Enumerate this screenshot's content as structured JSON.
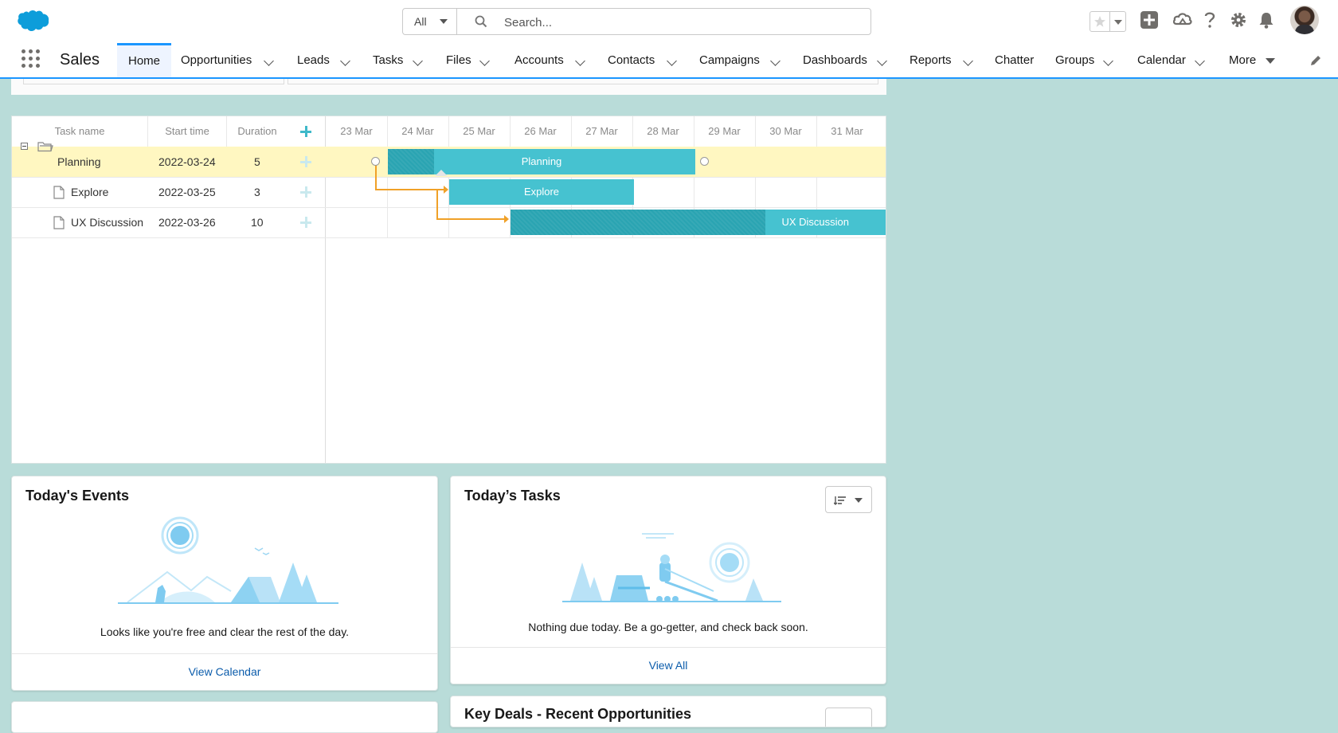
{
  "header": {
    "search": {
      "scope": "All",
      "placeholder": "Search..."
    }
  },
  "nav": {
    "app_name": "Sales",
    "tabs": [
      {
        "label": "Home",
        "active": true
      },
      {
        "label": "Opportunities"
      },
      {
        "label": "Leads"
      },
      {
        "label": "Tasks"
      },
      {
        "label": "Files"
      },
      {
        "label": "Accounts"
      },
      {
        "label": "Contacts"
      },
      {
        "label": "Campaigns"
      },
      {
        "label": "Dashboards"
      },
      {
        "label": "Reports"
      },
      {
        "label": "Chatter"
      },
      {
        "label": "Groups"
      },
      {
        "label": "Calendar"
      },
      {
        "label": "More"
      }
    ]
  },
  "gantt": {
    "columns": {
      "task_name": "Task name",
      "start_time": "Start time",
      "duration": "Duration"
    },
    "dates": [
      "23 Mar",
      "24 Mar",
      "25 Mar",
      "26 Mar",
      "27 Mar",
      "28 Mar",
      "29 Mar",
      "30 Mar",
      "31 Mar"
    ],
    "tasks": [
      {
        "name": "Planning",
        "start": "2022-03-24",
        "duration": "5",
        "type": "folder",
        "progress": 0.15
      },
      {
        "name": "Explore",
        "start": "2022-03-25",
        "duration": "3",
        "type": "file",
        "progress": 0
      },
      {
        "name": "UX Discussion",
        "start": "2022-03-26",
        "duration": "10",
        "type": "file",
        "progress": 0.3
      }
    ]
  },
  "events_card": {
    "title": "Today's Events",
    "message": "Looks like you're free and clear the rest of the day.",
    "link": "View Calendar"
  },
  "tasks_card": {
    "title": "Today’s Tasks",
    "message": "Nothing due today. Be a go-getter, and check back soon.",
    "link": "View All"
  },
  "bottom_card_right": {
    "title": "Key Deals - Recent Opportunities"
  },
  "colors": {
    "accent": "#1b96ff",
    "gantt_bar": "#46c2d0",
    "gantt_progress": "#2aa4b2",
    "link": "#f0a128",
    "highlight_row": "#fff7c1",
    "page_bg": "#b9dcd9"
  }
}
